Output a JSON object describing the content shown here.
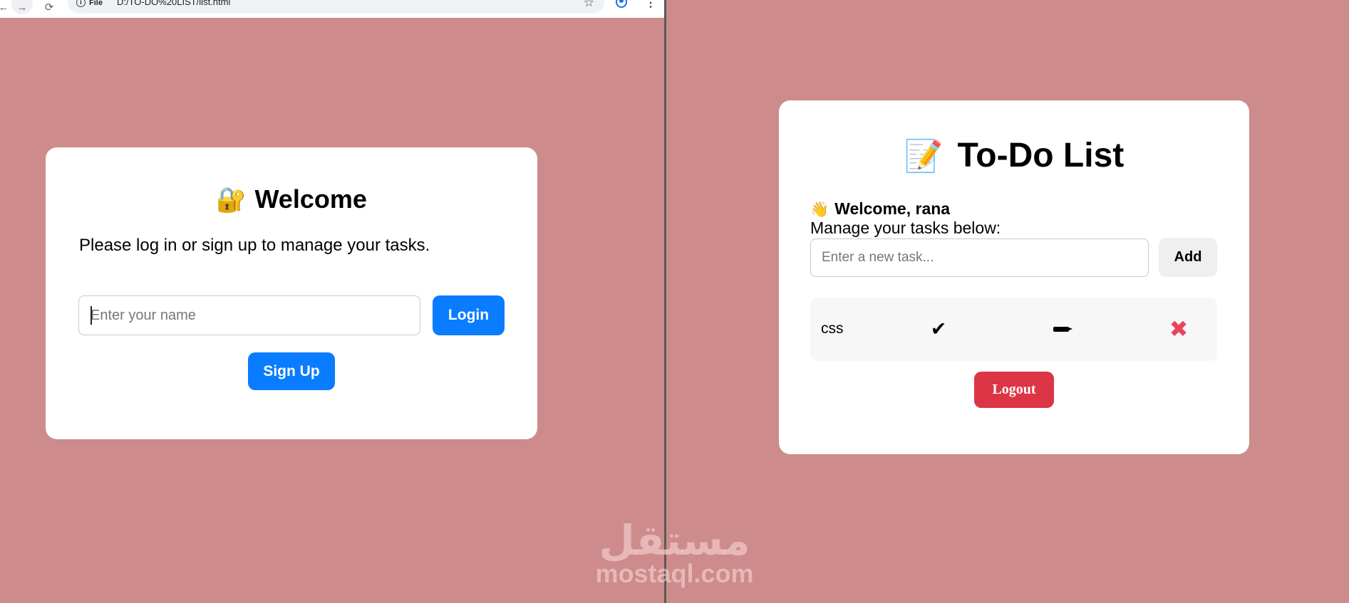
{
  "browser": {
    "nav": {
      "back": "←",
      "forward": "→",
      "reload": "⟳"
    },
    "info_icon": "i",
    "site_label": "File",
    "url": "D:/TO-DO%20LIST/list.html",
    "star": "☆",
    "menu": "⋮"
  },
  "login_card": {
    "icon": "🔐",
    "title": "Welcome",
    "subtitle": "Please log in or sign up to manage your tasks.",
    "name_placeholder": "Enter your name",
    "login_label": "Login",
    "signup_label": "Sign Up"
  },
  "todo_card": {
    "icon": "📝",
    "title": "To-Do List",
    "wave_icon": "👋",
    "welcome": "Welcome, rana",
    "manage_text": "Manage your tasks below:",
    "task_placeholder": "Enter a new task...",
    "add_label": "Add",
    "tasks": [
      {
        "text": "css",
        "complete_icon": "✔",
        "edit_icon": "pencil-icon",
        "delete_icon": "✖"
      }
    ],
    "logout_label": "Logout"
  },
  "watermark": {
    "arabic": "مستقل",
    "latin": "mostaql.com"
  },
  "colors": {
    "background": "#cd8b8b",
    "primary_blue": "#0a7cff",
    "logout_red": "#dc3545",
    "delete_pink": "#e8455d"
  }
}
